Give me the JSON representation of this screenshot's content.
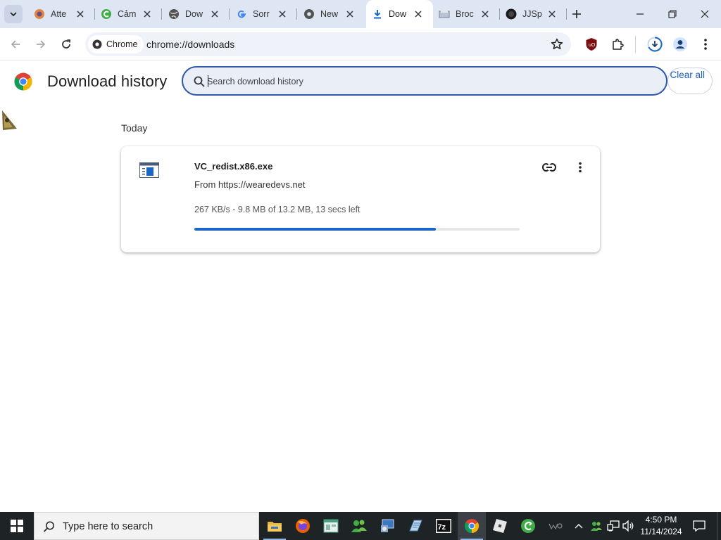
{
  "browser": {
    "tabs": [
      {
        "title": "Atte",
        "favicon": "spiral-app-icon",
        "active": false
      },
      {
        "title": "Cảm",
        "favicon": "green-c-icon",
        "active": false
      },
      {
        "title": "Dow",
        "favicon": "globe-icon",
        "active": false
      },
      {
        "title": "Sorr",
        "favicon": "google-icon",
        "active": false
      },
      {
        "title": "New",
        "favicon": "chrome-tab-icon",
        "active": false
      },
      {
        "title": "Dow",
        "favicon": "download-icon",
        "active": true
      },
      {
        "title": "Broc",
        "favicon": "page-icon",
        "active": false
      },
      {
        "title": "JJSp",
        "favicon": "dark-circle-icon",
        "active": false
      }
    ],
    "chip_label": "Chrome",
    "url": "chrome://downloads"
  },
  "downloads": {
    "page_title": "Download history",
    "search_placeholder": "Search download history",
    "clear_all_label": "Clear all",
    "sections": [
      {
        "date_label": "Today",
        "items": [
          {
            "file_name": "VC_redist.x86.exe",
            "source_text": "From https://wearedevs.net",
            "status_text": "267 KB/s - 9.8 MB of 13.2 MB, 13 secs left",
            "progress": 0.742
          }
        ]
      }
    ]
  },
  "taskbar": {
    "search_placeholder": "Type here to search",
    "time": "4:50 PM",
    "date": "11/14/2024",
    "pinned_apps": [
      "file-explorer-icon",
      "firefox-icon",
      "app-window-icon",
      "people-icon",
      "control-panel-icon",
      "notepad-icon",
      "7zip-icon",
      "chrome-icon",
      "roblox-icon",
      "ccleaner-icon"
    ]
  },
  "colors": {
    "accent": "#1a66c7",
    "tabstrip": "#dfe6f3",
    "search_border": "#2f58a8"
  }
}
